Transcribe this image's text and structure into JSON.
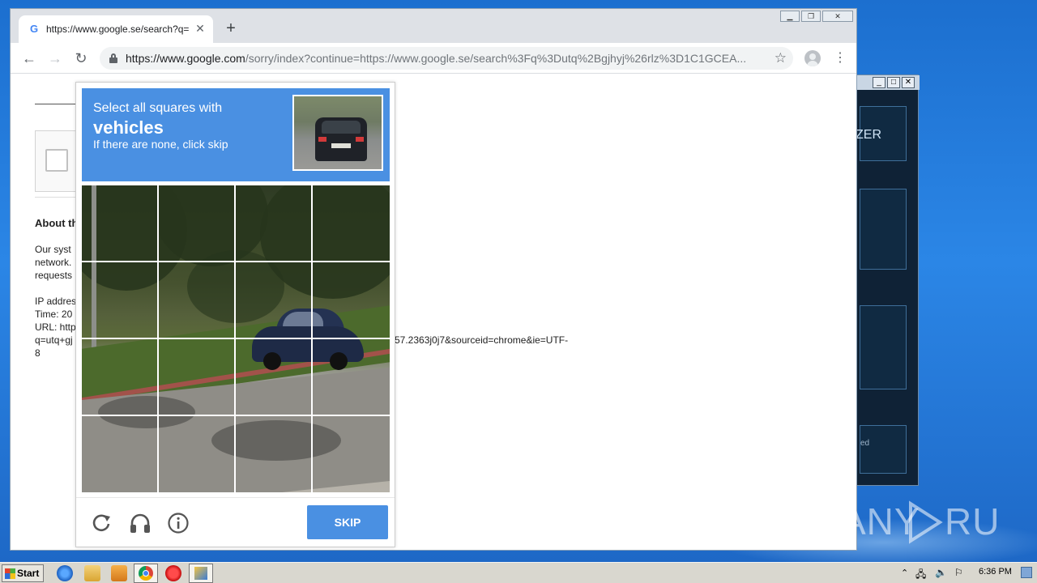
{
  "browser": {
    "tab": {
      "title": "https://www.google.se/search?q=ut",
      "favicon": "google-g-icon"
    },
    "new_tab_label": "+",
    "url_host": "https://www.google.com",
    "url_path": "/sorry/index?continue=https://www.google.se/search%3Fq%3Dutq%2Bgjhyj%26rlz%3D1C1GCEA...",
    "window_controls": [
      "minimize",
      "restore",
      "close"
    ]
  },
  "page": {
    "about_heading": "About th",
    "lines": [
      "Our syst",
      "network.",
      "requests"
    ],
    "ip_lines": [
      "IP addres",
      "Time: 20",
      "URL: http",
      "q=utq+gj",
      "8"
    ],
    "url_tail": "57.2363j0j7&sourceid=chrome&ie=UTF-"
  },
  "captcha": {
    "prompt_line1": "Select all squares with",
    "prompt_keyword": "vehicles",
    "prompt_line3": "If there are none, click skip",
    "grid": {
      "rows": 4,
      "cols": 4
    },
    "skip_label": "SKIP",
    "icons": [
      "reload-icon",
      "audio-headphones-icon",
      "info-icon"
    ]
  },
  "bg_app": {
    "panel_text": "ZER",
    "small_text": "ed"
  },
  "watermark": {
    "text": "ANY RUN"
  },
  "taskbar": {
    "start_label": "Start",
    "clock": "6:36 PM"
  }
}
